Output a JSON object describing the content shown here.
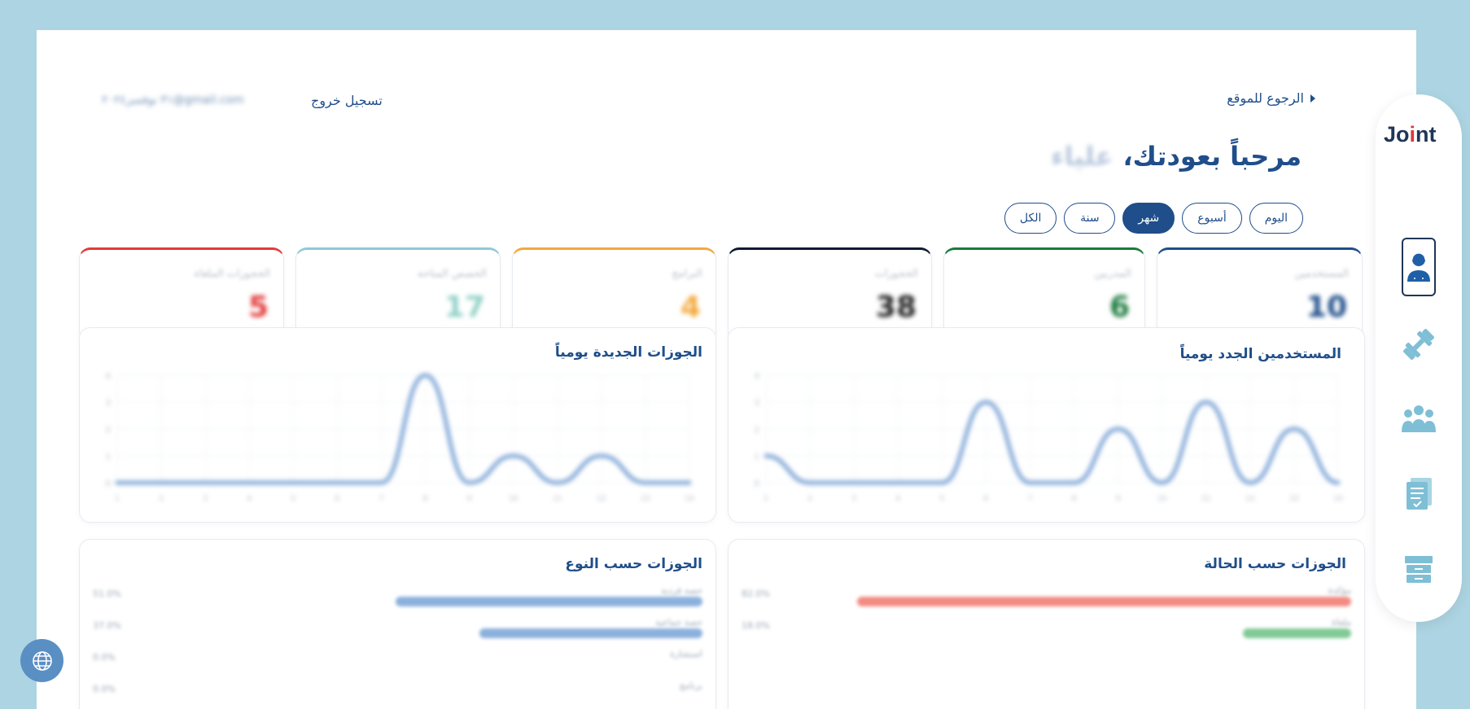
{
  "header": {
    "back_label": "الرجوع للموقع",
    "logout_label": "تسجيل خروج",
    "user_email": "٣١ نوفمبر٢٠٢٤@gmail.com"
  },
  "welcome": {
    "greeting": "مرحباً بعودتك،",
    "name": "علياء"
  },
  "period_tabs": [
    {
      "label": "اليوم"
    },
    {
      "label": "أسبوع"
    },
    {
      "label": "شهر"
    },
    {
      "label": "سنة"
    },
    {
      "label": "الكل"
    }
  ],
  "active_period": "شهر",
  "stats": [
    {
      "label": "المستخدمين",
      "value": "10",
      "color": "#1f4e8a"
    },
    {
      "label": "المدربين",
      "value": "6",
      "color": "#1a7a3c"
    },
    {
      "label": "الحجوزات",
      "value": "38",
      "color": "#0c1a33"
    },
    {
      "label": "البرامج",
      "value": "4",
      "color": "#f2a93b"
    },
    {
      "label": "الحصص المتاحة",
      "value": "17",
      "color": "#8fc9d8"
    },
    {
      "label": "الحجوزات الملغاة",
      "value": "5",
      "color": "#e23a3a"
    }
  ],
  "charts": {
    "users_daily_title": "المستخدمين الجدد يومياً",
    "bookings_daily_title": "الجوزات الجديدة يومياً",
    "status_title": "الجوزات حسب الحالة",
    "type_title": "الجوزات حسب النوع"
  },
  "chart_data": [
    {
      "type": "line",
      "title": "المستخدمين الجدد يومياً",
      "x": [
        1,
        2,
        3,
        4,
        5,
        6,
        7,
        8,
        9,
        10,
        11,
        12,
        13,
        14
      ],
      "values": [
        1,
        0,
        0,
        0,
        0,
        3,
        0,
        0,
        2,
        0,
        3,
        0,
        2,
        0
      ],
      "ylim": [
        0,
        4
      ]
    },
    {
      "type": "line",
      "title": "الجوزات الجديدة يومياً",
      "x": [
        1,
        2,
        3,
        4,
        5,
        6,
        7,
        8,
        9,
        10,
        11,
        12,
        13,
        14
      ],
      "values": [
        0,
        0,
        0,
        0,
        0,
        0,
        0,
        4,
        0,
        1,
        0,
        1,
        0,
        0
      ],
      "ylim": [
        0,
        4
      ]
    },
    {
      "type": "bar",
      "title": "الجوزات حسب الحالة",
      "categories": [
        "مؤكدة",
        "ملغاة"
      ],
      "values": [
        82,
        18
      ],
      "colors": [
        "#f28b82",
        "#81c995"
      ]
    },
    {
      "type": "bar",
      "title": "الجوزات حسب النوع",
      "categories": [
        "حصة فردية",
        "حصة جماعية",
        "استشارة",
        "برنامج"
      ],
      "values": [
        51,
        37,
        0,
        0
      ],
      "colors": [
        "#8ab0dc",
        "#8ab0dc",
        "#8ab0dc",
        "#8ab0dc"
      ]
    }
  ],
  "sidebar": {
    "logo_text_a": "Jo",
    "logo_text_dot": "i",
    "logo_text_b": "nt",
    "items": [
      {
        "icon": "user-icon"
      },
      {
        "icon": "dumbbell-icon"
      },
      {
        "icon": "group-icon"
      },
      {
        "icon": "document-icon"
      },
      {
        "icon": "archive-icon"
      }
    ]
  },
  "language_icon": "globe-icon"
}
